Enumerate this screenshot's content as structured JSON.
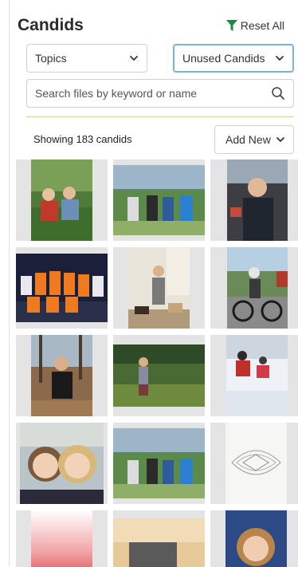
{
  "header": {
    "title": "Candids",
    "reset_label": "Reset All",
    "reset_color": "#1e8a3c"
  },
  "filters": {
    "topics_label": "Topics",
    "status_label": "Unused Candids"
  },
  "search": {
    "placeholder": "Search files by keyword or name",
    "icon": "search-icon"
  },
  "toolbar": {
    "count_text": "Showing 183 candids",
    "add_new_label": "Add New"
  },
  "photos": [
    {
      "name": "photo-girls-grass"
    },
    {
      "name": "photo-team-golf-course"
    },
    {
      "name": "photo-boy-in-car"
    },
    {
      "name": "photo-soccer-team-orange"
    },
    {
      "name": "photo-person-with-dogs"
    },
    {
      "name": "photo-boy-bicycle"
    },
    {
      "name": "photo-girl-in-leaves"
    },
    {
      "name": "photo-girl-in-field"
    },
    {
      "name": "photo-kids-in-snow"
    },
    {
      "name": "photo-two-girls-selfie"
    },
    {
      "name": "photo-team-golf-course-2"
    },
    {
      "name": "photo-sketch-drawing"
    },
    {
      "name": "photo-red-gradient"
    },
    {
      "name": "photo-laptop-desk"
    },
    {
      "name": "photo-portrait-woman"
    }
  ]
}
